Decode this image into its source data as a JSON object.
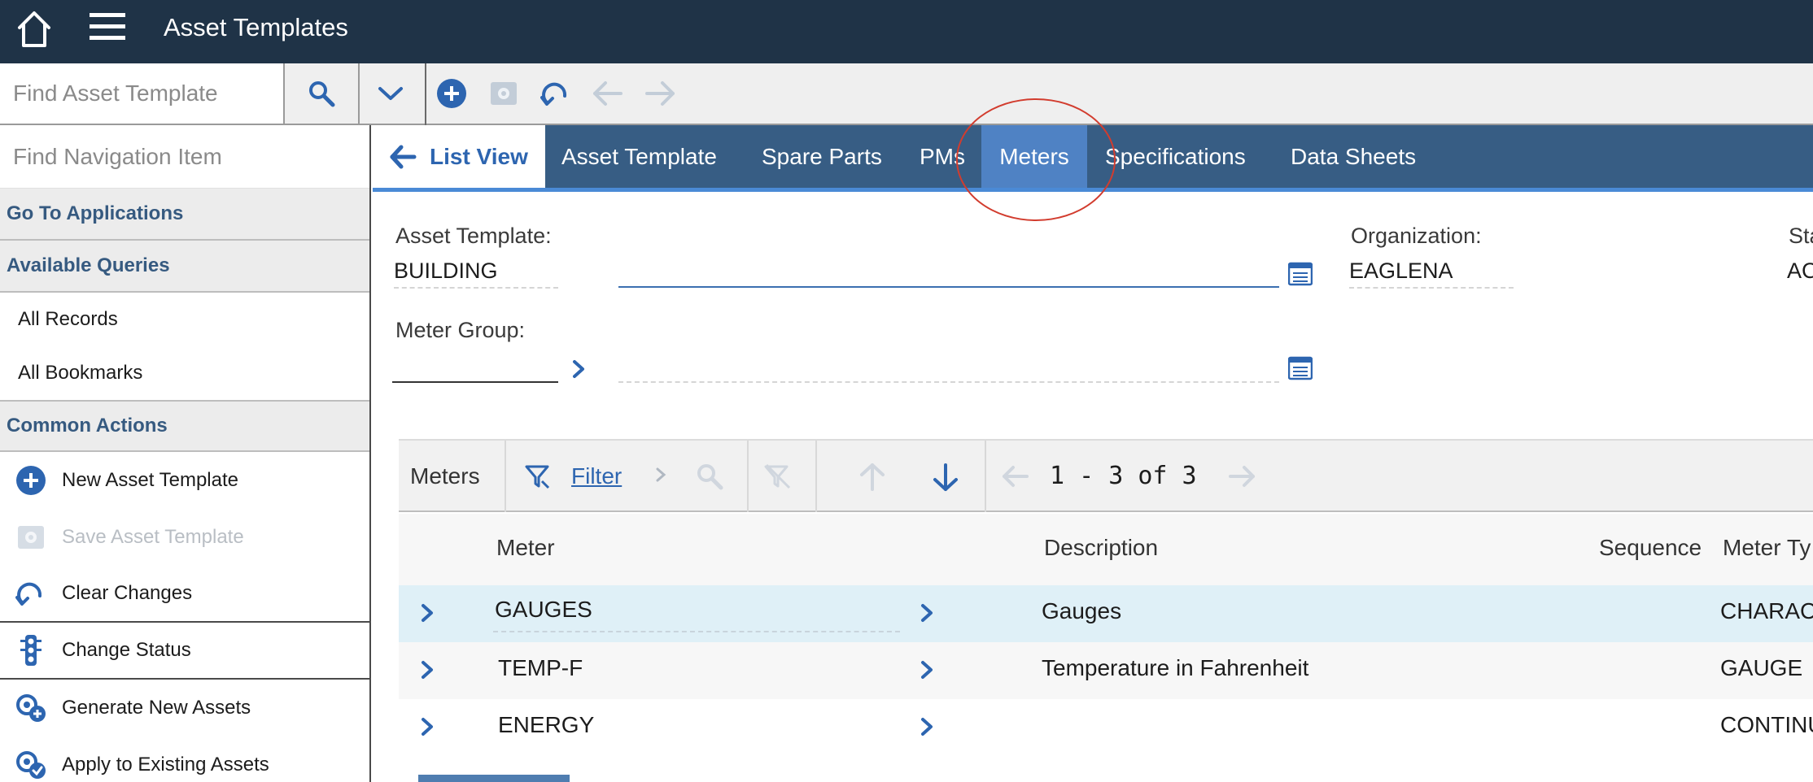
{
  "header": {
    "title": "Asset Templates",
    "bg_color": "#1f3347"
  },
  "toolbar": {
    "find_placeholder": "Find Asset Template"
  },
  "nav": {
    "find_placeholder": "Find Navigation Item",
    "go_to_applications": "Go To Applications",
    "available_queries": "Available Queries",
    "queries": [
      "All Records",
      "All Bookmarks"
    ],
    "common_actions": "Common Actions",
    "actions": [
      {
        "label": "New Asset Template",
        "icon": "add-icon",
        "enabled": true
      },
      {
        "label": "Save Asset Template",
        "icon": "save-icon",
        "enabled": false
      },
      {
        "label": "Clear Changes",
        "icon": "undo-icon",
        "enabled": true
      },
      {
        "label": "Change Status",
        "icon": "traffic-light-icon",
        "enabled": true
      },
      {
        "label": "Generate New Assets",
        "icon": "generate-assets-icon",
        "enabled": true
      },
      {
        "label": "Apply to Existing Assets",
        "icon": "apply-assets-icon",
        "enabled": true
      }
    ]
  },
  "tabs": {
    "list_view": "List View",
    "items": [
      "Asset Template",
      "Spare Parts",
      "PMs",
      "Meters",
      "Specifications",
      "Data Sheets"
    ],
    "active": "Meters",
    "accent": "#4f82c4"
  },
  "form": {
    "asset_template_label": "Asset Template:",
    "asset_template_value": "BUILDING",
    "organization_label": "Organization:",
    "organization_value": "EAGLENA",
    "status_label_partial": "Sta",
    "status_value_partial": "AC",
    "meter_group_label": "Meter Group:"
  },
  "meters_table": {
    "title": "Meters",
    "filter_label": "Filter",
    "pagination": "1 - 3 of 3",
    "columns": [
      "Meter",
      "Description",
      "Sequence",
      "Meter Ty"
    ],
    "rows": [
      {
        "meter": "GAUGES",
        "description": "Gauges",
        "sequence": "",
        "meter_type": "CHARACT"
      },
      {
        "meter": "TEMP-F",
        "description": "Temperature in Fahrenheit",
        "sequence": "",
        "meter_type": "GAUGE"
      },
      {
        "meter": "ENERGY",
        "description": "",
        "sequence": "",
        "meter_type": "CONTINU"
      }
    ],
    "selected_row_color": "#dff0f7"
  }
}
